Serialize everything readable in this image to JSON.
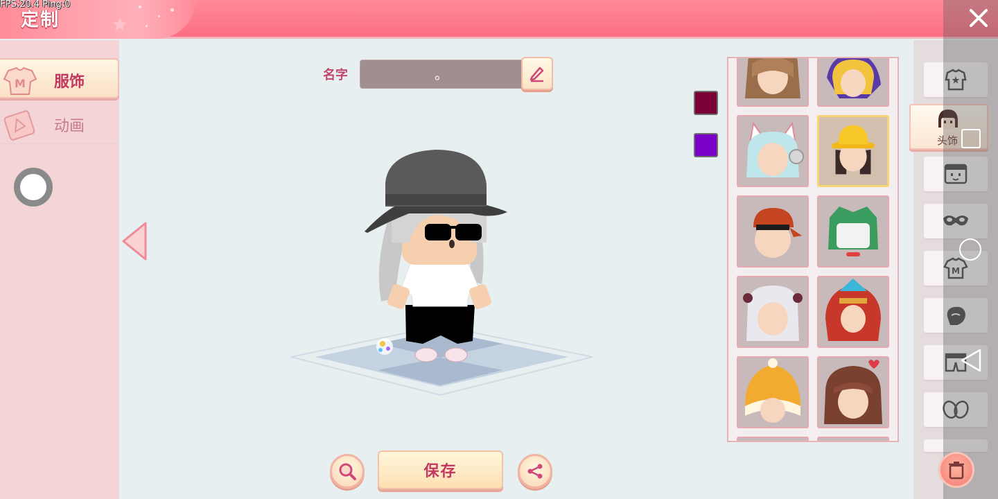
{
  "debug": {
    "fps_text": "FPS:20.4  Ping:0"
  },
  "header": {
    "title": "定制"
  },
  "left_tabs": [
    {
      "label": "服饰",
      "icon": "shirt-M-icon",
      "active": true
    },
    {
      "label": "动画",
      "icon": "animation-triangle-icon",
      "active": false
    }
  ],
  "name": {
    "label": "名字",
    "value": "。"
  },
  "color_swatches": [
    "#7a0036",
    "#7b00c7"
  ],
  "item_grid": {
    "items": [
      {
        "name": "brown-long-hair",
        "selected": false
      },
      {
        "name": "blonde-witch-hat",
        "selected": false
      },
      {
        "name": "cat-ear-headphones-cyan-hair",
        "selected": false
      },
      {
        "name": "yellow-bucket-hat",
        "selected": true
      },
      {
        "name": "red-backwards-cap",
        "selected": false
      },
      {
        "name": "green-mecha-helmet",
        "selected": false
      },
      {
        "name": "white-twin-tails-ribbons",
        "selected": false
      },
      {
        "name": "feather-headdress",
        "selected": false
      },
      {
        "name": "orange-fluffy-hood",
        "selected": false
      },
      {
        "name": "brown-hair-heart-clip",
        "selected": false
      }
    ]
  },
  "categories": [
    {
      "name": "outfit",
      "icon": "suit-star-icon",
      "label": ""
    },
    {
      "name": "headwear",
      "icon": "face-hair-icon",
      "label": "头饰",
      "active": true
    },
    {
      "name": "face",
      "icon": "face-box-icon",
      "label": ""
    },
    {
      "name": "mask",
      "icon": "eye-mask-icon",
      "label": ""
    },
    {
      "name": "top",
      "icon": "tshirt-M-icon",
      "label": ""
    },
    {
      "name": "hand",
      "icon": "glove-icon",
      "label": ""
    },
    {
      "name": "pants",
      "icon": "shorts-icon",
      "label": ""
    },
    {
      "name": "shoes",
      "icon": "shoes-icon",
      "label": ""
    }
  ],
  "buttons": {
    "save": "保存",
    "zoom": "zoom-icon",
    "share": "share-icon",
    "trash": "trash-icon",
    "close": "close-icon"
  },
  "colors": {
    "header": "#fb6f82",
    "accent_text": "#c2385f",
    "selected_border": "#f7d572"
  }
}
